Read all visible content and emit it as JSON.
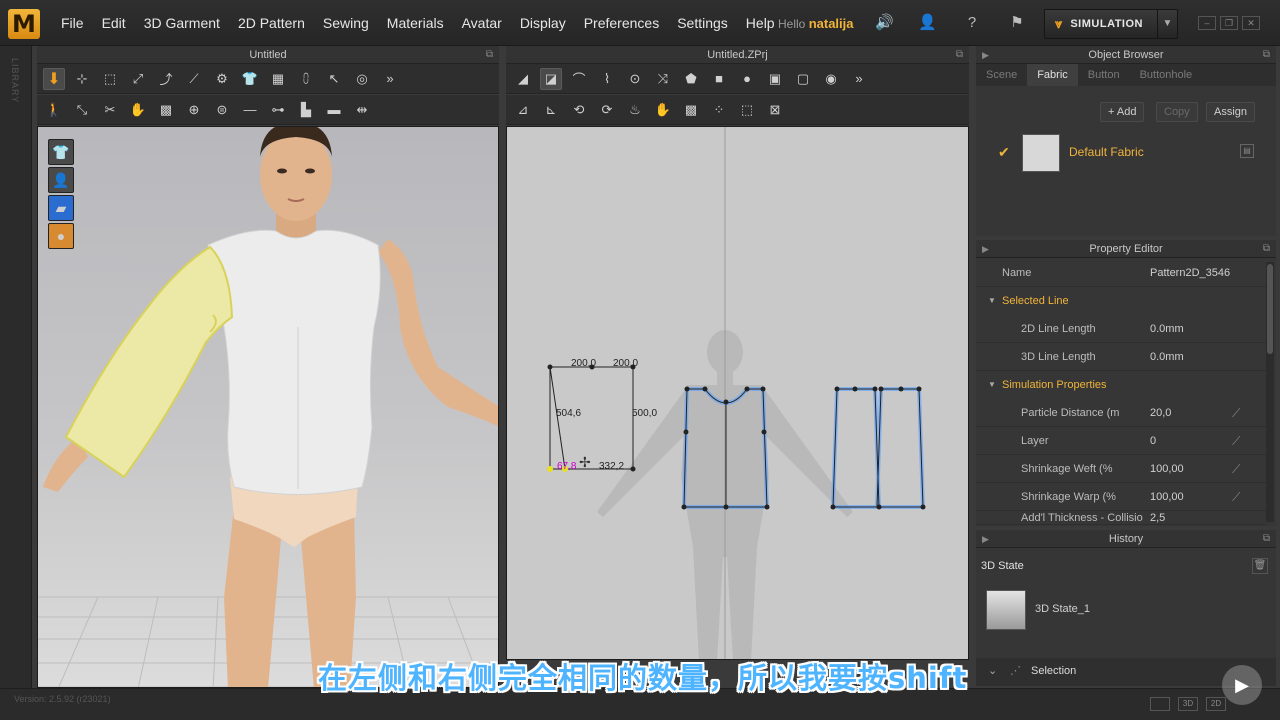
{
  "app": {
    "logo_letter": "M",
    "menu": [
      "File",
      "Edit",
      "3D Garment",
      "2D Pattern",
      "Sewing",
      "Materials",
      "Avatar",
      "Display",
      "Preferences",
      "Settings",
      "Help"
    ],
    "hello_text": "Hello",
    "username": "natalija",
    "simulation_label": "SIMULATION",
    "library_label": "LIBRARY"
  },
  "panels": {
    "left_title": "Untitled",
    "center_title": "Untitled.ZPrj",
    "object_browser_title": "Object Browser",
    "property_editor_title": "Property Editor",
    "history_title": "History"
  },
  "object_browser": {
    "tabs": [
      "Scene",
      "Fabric",
      "Button",
      "Buttonhole"
    ],
    "active_tab": "Fabric",
    "add_label": "+ Add",
    "copy_label": "Copy",
    "assign_label": "Assign",
    "fabric_name": "Default Fabric"
  },
  "property_editor": {
    "name_label": "Name",
    "name_value": "Pattern2D_3546",
    "selected_line_label": "Selected Line",
    "rows_line": [
      {
        "k": "2D Line Length",
        "v": "0.0mm"
      },
      {
        "k": "3D Line Length",
        "v": "0.0mm"
      }
    ],
    "simulation_label": "Simulation Properties",
    "rows_sim": [
      {
        "k": "Particle Distance (m",
        "v": "20,0"
      },
      {
        "k": "Layer",
        "v": "0"
      },
      {
        "k": "Shrinkage Weft (%",
        "v": "100,00"
      },
      {
        "k": "Shrinkage Warp (%",
        "v": "100,00"
      },
      {
        "k": "Add'l Thickness - Collisio",
        "v": "2,5"
      }
    ]
  },
  "history": {
    "state_label": "3D State",
    "item": "3D State_1"
  },
  "selection_label": "Selection",
  "pattern_measurements": {
    "top_left": "200,0",
    "top_right": "200,0",
    "left": "504,6",
    "right": "500,0",
    "bottom_left": "67,8",
    "bottom_right": "332,2"
  },
  "version": "Version: 2.5.92    (r23021)",
  "subtitle": "在左侧和右侧完全相同的数量，所以我要按shift",
  "colors": {
    "accent": "#f0b43a",
    "pattern_outline": "#5aa0ff",
    "sleeve": "#ece9a6"
  }
}
